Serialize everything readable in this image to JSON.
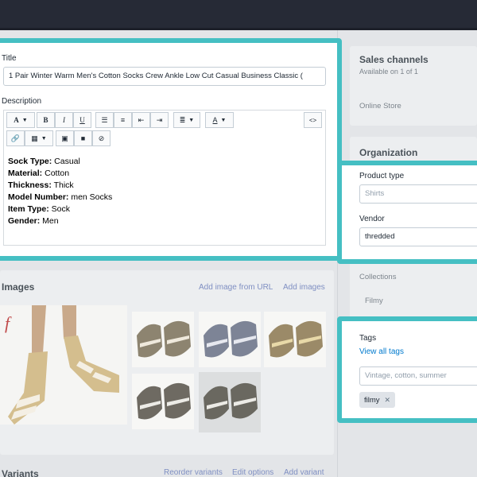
{
  "product": {
    "title_label": "Title",
    "title_value": "1 Pair Winter Warm Men's Cotton Socks Crew Ankle Low Cut Casual Business Classic (",
    "description_label": "Description",
    "description": [
      {
        "key": "Sock Type:",
        "value": " Casual"
      },
      {
        "key": "Material:",
        "value": " Cotton"
      },
      {
        "key": "Thickness:",
        "value": " Thick"
      },
      {
        "key": "Model Number:",
        "value": " men Socks"
      },
      {
        "key": "Item Type:",
        "value": " Sock"
      },
      {
        "key": "Gender:",
        "value": " Men"
      }
    ],
    "toolbar": {
      "font": "A",
      "bold": "B",
      "italic": "I",
      "underline": "U",
      "code": "<>"
    }
  },
  "images": {
    "title": "Images",
    "add_from_url": "Add image from URL",
    "add_images": "Add images"
  },
  "variants": {
    "title": "Variants",
    "reorder": "Reorder variants",
    "edit_options": "Edit options",
    "add_variant": "Add variant"
  },
  "sidebar": {
    "sales_channels_title": "Sales channels",
    "sales_channels_sub": "Available on 1 of 1",
    "online_store": "Online Store",
    "organization_title": "Organization",
    "product_type_label": "Product type",
    "product_type_placeholder": "Shirts",
    "vendor_label": "Vendor",
    "vendor_value": "thredded",
    "collections_label": "Collections",
    "collections_value": "Filmy",
    "tags_label": "Tags",
    "view_all_tags": "View all tags",
    "tags_placeholder": "Vintage, cotton, summer",
    "tags": [
      "filmy"
    ]
  },
  "colors": {
    "highlight": "#45bfc3",
    "topbar": "#262a36",
    "link": "#007ace"
  }
}
